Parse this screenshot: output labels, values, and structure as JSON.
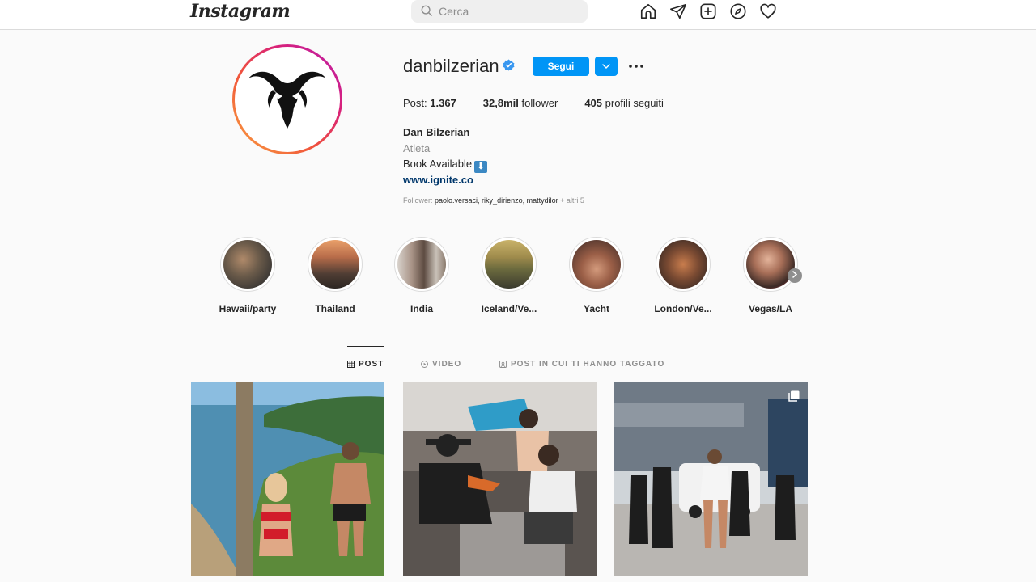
{
  "brand": {
    "logo_text": "Instagram"
  },
  "search": {
    "placeholder": "Cerca"
  },
  "nav": {
    "icons": [
      "home-icon",
      "direct-message-icon",
      "new-post-icon",
      "explore-icon",
      "activity-heart-icon"
    ]
  },
  "profile": {
    "username": "danbilzerian",
    "verified": true,
    "follow_label": "Segui",
    "stats": {
      "posts_count": "1.367",
      "posts_label": "Post:",
      "followers_count": "32,8mil",
      "followers_label": "follower",
      "following_count": "405",
      "following_label": "profili seguiti"
    },
    "full_name": "Dan Bilzerian",
    "category": "Atleta",
    "bio": "Book Available",
    "bio_emoji": "⬇",
    "website": "www.ignite.co",
    "followed_by_prefix": "Follower:",
    "followed_by_names": "paolo.versaci, riky_dirienzo, mattydilor",
    "followed_by_more": "+ altri 5"
  },
  "highlights": [
    {
      "label": "Hawaii/party"
    },
    {
      "label": "Thailand"
    },
    {
      "label": "India"
    },
    {
      "label": "Iceland/Ve..."
    },
    {
      "label": "Yacht"
    },
    {
      "label": "London/Ve..."
    },
    {
      "label": "Vegas/LA"
    }
  ],
  "tabs": [
    {
      "label": "Post",
      "active": true
    },
    {
      "label": "Video",
      "active": false
    },
    {
      "label": "Post in cui ti hanno taggato",
      "active": false
    }
  ],
  "colors": {
    "accent": "#0095f6",
    "link": "#00376b",
    "border": "#dbdbdb",
    "muted": "#8e8e8e"
  }
}
